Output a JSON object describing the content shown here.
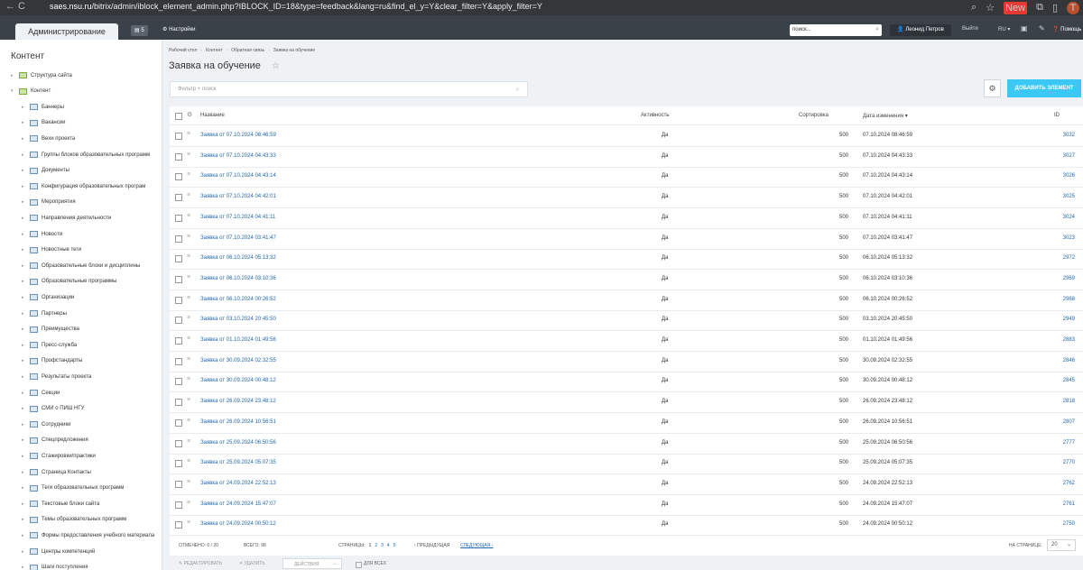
{
  "browser": {
    "url_host": "saes.nsu.ru",
    "url_path": "/bitrix/admin/iblock_element_admin.php?IBLOCK_ID=18&type=feedback&lang=ru&find_el_y=Y&clear_filter=Y&apply_filter=Y",
    "new_badge": "New",
    "profile_initial": "T"
  },
  "topbar": {
    "admin_tab": "Администрирование",
    "counter": "5",
    "settings": "Настройки",
    "search_value": "поиск...",
    "user": "Леонид Петров",
    "logout": "Выйти",
    "lang": "RU",
    "help": "Помощь"
  },
  "sidebar": {
    "title": "Контент",
    "items": [
      {
        "label": "Структура сайта",
        "level": 0,
        "expanded": false
      },
      {
        "label": "Контент",
        "level": 0,
        "expanded": true
      },
      {
        "label": "Баннеры",
        "level": 1
      },
      {
        "label": "Вакансии",
        "level": 1
      },
      {
        "label": "Вехи проекта",
        "level": 1
      },
      {
        "label": "Группы блоков образовательных программ",
        "level": 1
      },
      {
        "label": "Документы",
        "level": 1
      },
      {
        "label": "Конфигурация образовательных програм",
        "level": 1
      },
      {
        "label": "Мероприятия",
        "level": 1
      },
      {
        "label": "Направления деятельности",
        "level": 1
      },
      {
        "label": "Новости",
        "level": 1
      },
      {
        "label": "Новостные теги",
        "level": 1
      },
      {
        "label": "Образовательные блоки и дисциплины",
        "level": 1
      },
      {
        "label": "Образовательные программы",
        "level": 1
      },
      {
        "label": "Организации",
        "level": 1
      },
      {
        "label": "Партнеры",
        "level": 1
      },
      {
        "label": "Преимущества",
        "level": 1
      },
      {
        "label": "Пресс-служба",
        "level": 1
      },
      {
        "label": "Профстандарты",
        "level": 1
      },
      {
        "label": "Результаты проекта",
        "level": 1
      },
      {
        "label": "Секции",
        "level": 1
      },
      {
        "label": "СМИ о ПИШ НГУ",
        "level": 1
      },
      {
        "label": "Сотрудники",
        "level": 1
      },
      {
        "label": "Спецпредложения",
        "level": 1
      },
      {
        "label": "Стажировки/практики",
        "level": 1
      },
      {
        "label": "Страница Контакты",
        "level": 1
      },
      {
        "label": "Теги образовательных программ",
        "level": 1
      },
      {
        "label": "Текстовые блоки сайта",
        "level": 1
      },
      {
        "label": "Темы образовательных программ",
        "level": 1
      },
      {
        "label": "Формы предоставления учебного материала",
        "level": 1
      },
      {
        "label": "Центры компетенций",
        "level": 1
      },
      {
        "label": "Шаги поступления",
        "level": 1
      }
    ]
  },
  "breadcrumbs": [
    "Рабочий стол",
    "Контент",
    "Обратная связь",
    "Заявка на обучение"
  ],
  "page_title": "Заявка на обучение",
  "filter_placeholder": "Фильтр + поиск",
  "add_button": "ДОБАВИТЬ ЭЛЕМЕНТ",
  "columns": {
    "name": "Название",
    "active": "Активность",
    "sort": "Сортировка",
    "date": "Дата изменения",
    "id": "ID"
  },
  "rows": [
    {
      "name": "Заявка от 07.10.2024 08:46:59",
      "active": "Да",
      "sort": "500",
      "date": "07.10.2024 08:46:59",
      "id": "3032"
    },
    {
      "name": "Заявка от 07.10.2024 04:43:33",
      "active": "Да",
      "sort": "500",
      "date": "07.10.2024 04:43:33",
      "id": "3027"
    },
    {
      "name": "Заявка от 07.10.2024 04:43:14",
      "active": "Да",
      "sort": "500",
      "date": "07.10.2024 04:43:14",
      "id": "3026"
    },
    {
      "name": "Заявка от 07.10.2024 04:42:01",
      "active": "Да",
      "sort": "500",
      "date": "07.10.2024 04:42:01",
      "id": "3025"
    },
    {
      "name": "Заявка от 07.10.2024 04:41:11",
      "active": "Да",
      "sort": "500",
      "date": "07.10.2024 04:41:11",
      "id": "3024"
    },
    {
      "name": "Заявка от 07.10.2024 03:41:47",
      "active": "Да",
      "sort": "500",
      "date": "07.10.2024 03:41:47",
      "id": "3023"
    },
    {
      "name": "Заявка от 06.10.2024 05:13:32",
      "active": "Да",
      "sort": "500",
      "date": "06.10.2024 05:13:32",
      "id": "2972"
    },
    {
      "name": "Заявка от 06.10.2024 03:10:36",
      "active": "Да",
      "sort": "500",
      "date": "06.10.2024 03:10:36",
      "id": "2969"
    },
    {
      "name": "Заявка от 06.10.2024 00:26:52",
      "active": "Да",
      "sort": "500",
      "date": "06.10.2024 00:26:52",
      "id": "2968"
    },
    {
      "name": "Заявка от 03.10.2024 20:45:50",
      "active": "Да",
      "sort": "500",
      "date": "03.10.2024 20:45:50",
      "id": "2949"
    },
    {
      "name": "Заявка от 01.10.2024 01:49:56",
      "active": "Да",
      "sort": "500",
      "date": "01.10.2024 01:49:56",
      "id": "2883"
    },
    {
      "name": "Заявка от 30.09.2024 02:32:55",
      "active": "Да",
      "sort": "500",
      "date": "30.09.2024 02:32:55",
      "id": "2846"
    },
    {
      "name": "Заявка от 30.09.2024 00:48:12",
      "active": "Да",
      "sort": "500",
      "date": "30.09.2024 00:48:12",
      "id": "2845"
    },
    {
      "name": "Заявка от 26.09.2024 23:48:12",
      "active": "Да",
      "sort": "500",
      "date": "26.09.2024 23:48:12",
      "id": "2818"
    },
    {
      "name": "Заявка от 26.09.2024 10:56:51",
      "active": "Да",
      "sort": "500",
      "date": "26.09.2024 10:56:51",
      "id": "2807"
    },
    {
      "name": "Заявка от 25.09.2024 06:50:56",
      "active": "Да",
      "sort": "500",
      "date": "25.09.2024 06:50:56",
      "id": "2777"
    },
    {
      "name": "Заявка от 25.09.2024 05:07:35",
      "active": "Да",
      "sort": "500",
      "date": "25.09.2024 05:07:35",
      "id": "2770"
    },
    {
      "name": "Заявка от 24.09.2024 22:52:13",
      "active": "Да",
      "sort": "500",
      "date": "24.09.2024 22:52:13",
      "id": "2762"
    },
    {
      "name": "Заявка от 24.09.2024 15:47:07",
      "active": "Да",
      "sort": "500",
      "date": "24.09.2024 15:47:07",
      "id": "2761"
    },
    {
      "name": "Заявка от 24.09.2024 00:50:12",
      "active": "Да",
      "sort": "500",
      "date": "24.09.2024 00:50:12",
      "id": "2750"
    }
  ],
  "footer": {
    "selected": "ОТМЕЧЕНО: 0 / 20",
    "total": "ВСЕГО: 98",
    "pages_label": "СТРАНИЦЫ:",
    "pages": [
      "1",
      "2",
      "3",
      "4",
      "5"
    ],
    "prev": "ПРЕДЫДУЩАЯ",
    "next": "СЛЕДУЮЩАЯ",
    "per_page_label": "НА СТРАНИЦЕ:",
    "per_page": "20"
  },
  "actions": {
    "edit": "РЕДАКТИРОВАТЬ",
    "delete": "УДАЛИТЬ",
    "select": "ДЕЙСТВИЯ",
    "for_all": "ДЛЯ ВСЕХ"
  },
  "colors": {
    "accent": "#3bc8f5",
    "link": "#2067b0",
    "admin_bar": "#3a4148"
  }
}
